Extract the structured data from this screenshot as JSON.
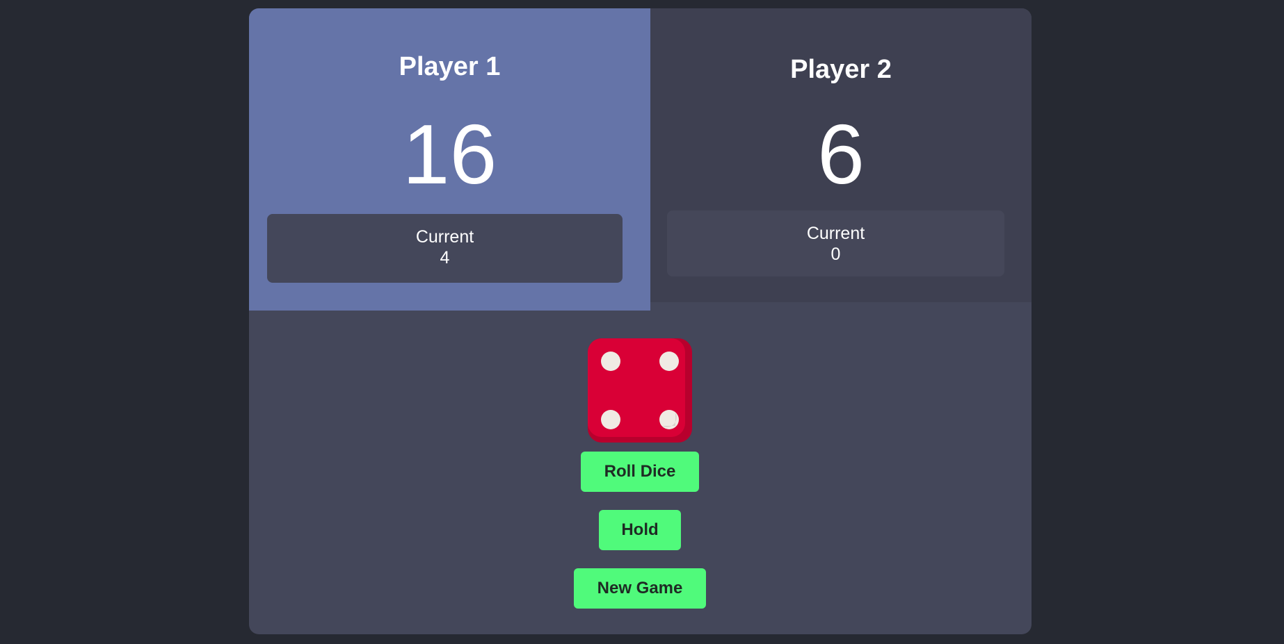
{
  "players": [
    {
      "name": "Player 1",
      "score": "16",
      "current_label": "Current",
      "current_value": "4",
      "active": true
    },
    {
      "name": "Player 2",
      "score": "6",
      "current_label": "Current",
      "current_value": "0",
      "active": false
    }
  ],
  "dice": {
    "value": 4,
    "icon": "dice-four-icon"
  },
  "buttons": {
    "roll": "Roll Dice",
    "hold": "Hold",
    "new_game": "New Game"
  },
  "colors": {
    "background": "#262932",
    "board": "#44475a",
    "active_player": "#6574a8",
    "inactive_player": "#3e4051",
    "button": "#50fa7b",
    "dice": "#d90036",
    "dice_dark": "#b8002d",
    "pip": "#f0ebe4"
  }
}
